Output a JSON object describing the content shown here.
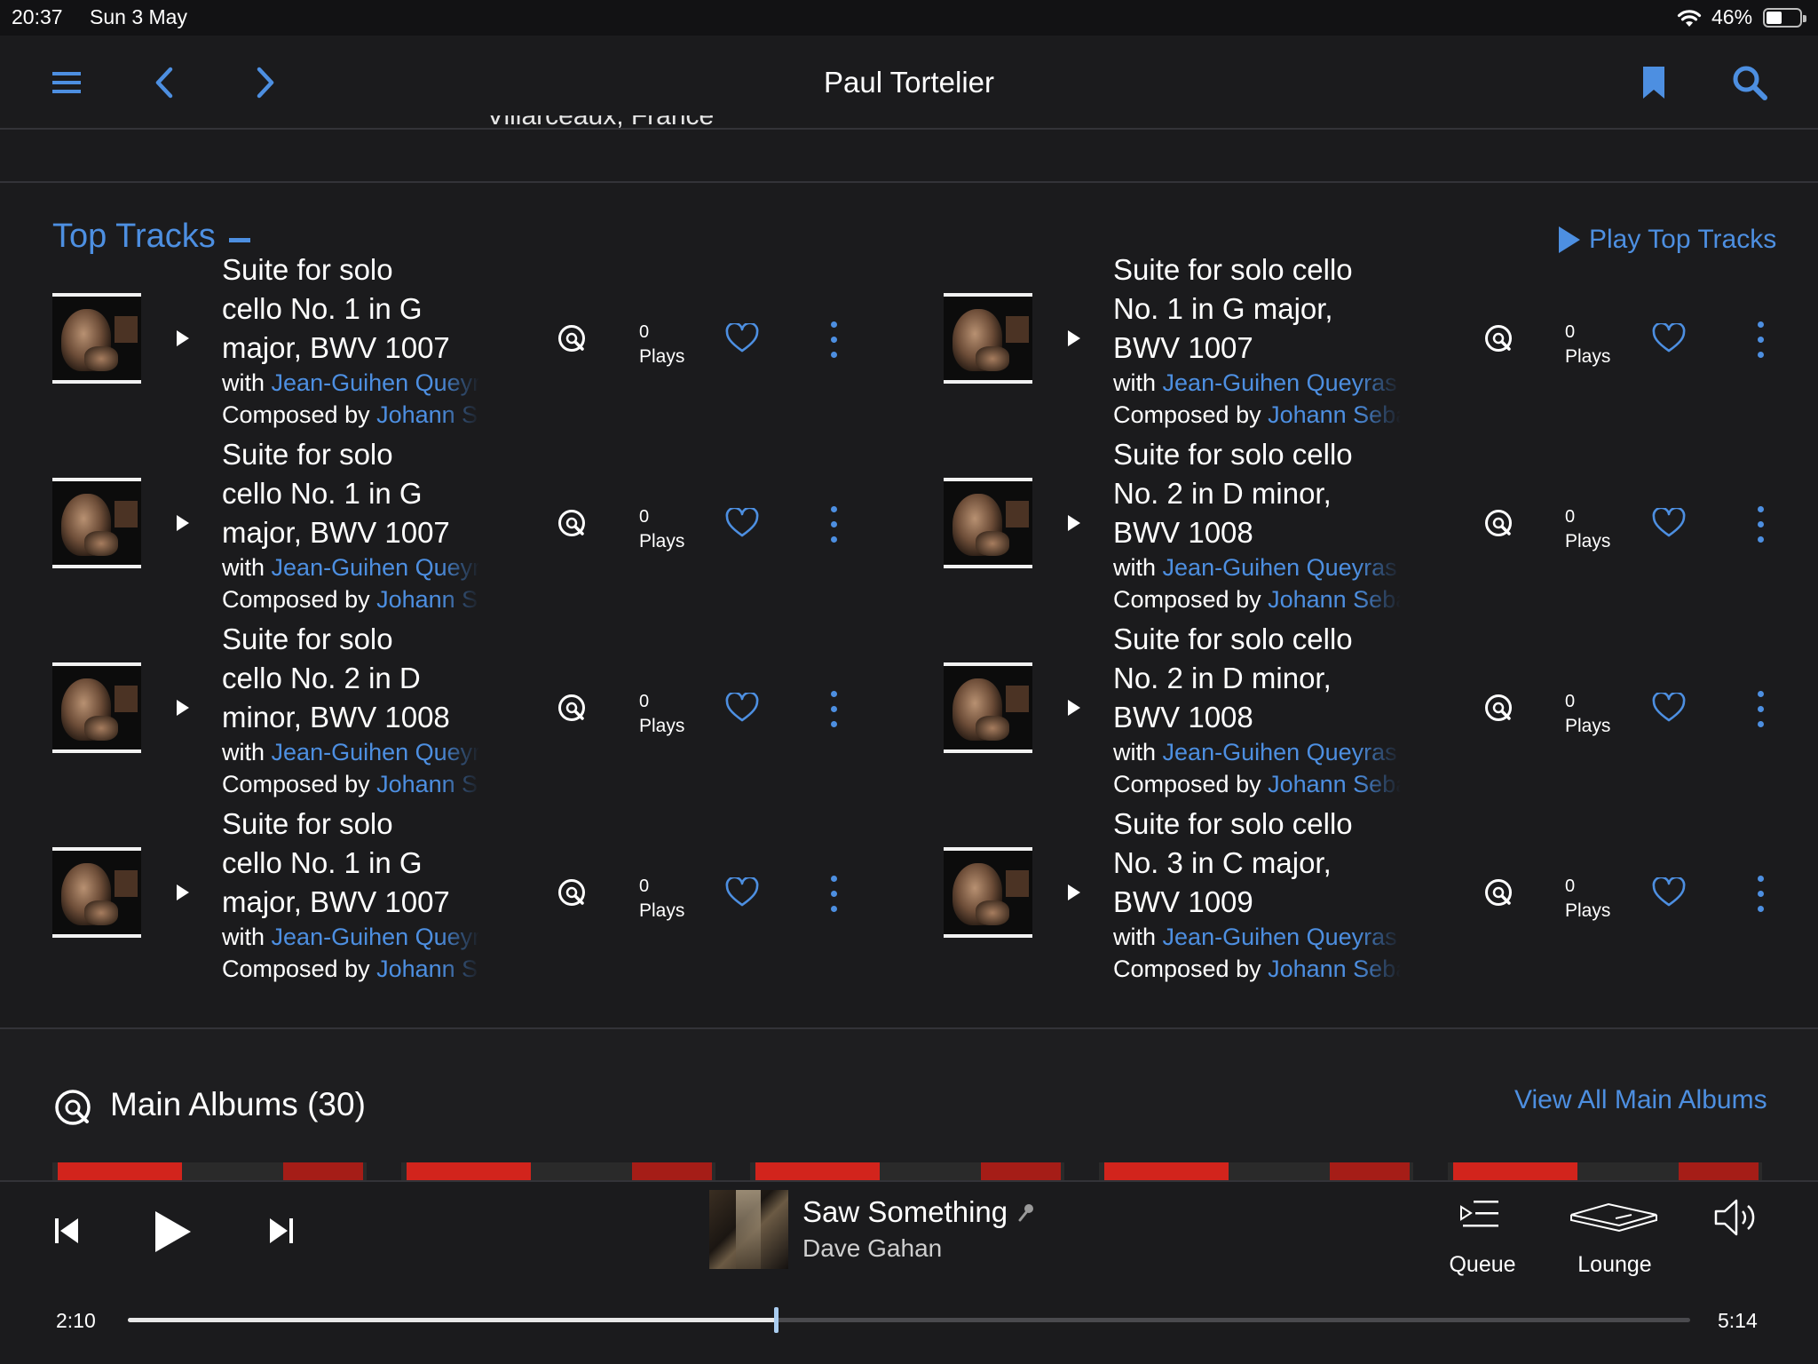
{
  "status_bar": {
    "time": "20:37",
    "date": "Sun 3 May",
    "battery_percent": "46%",
    "battery_level": 0.46
  },
  "nav": {
    "title": "Paul Tortelier",
    "menu_icon": "hamburger-menu-icon",
    "back_icon": "chevron-left-icon",
    "forward_icon": "chevron-right-icon",
    "bookmark_icon": "bookmark-icon",
    "search_icon": "search-icon"
  },
  "clipped_text": "Villarceaux, France",
  "top_tracks": {
    "title": "Top Tracks",
    "play_label": "Play Top Tracks",
    "tracks": [
      {
        "title_lines": [
          "Suite for solo",
          "cello No. 1 in G",
          "major, BWV 1007"
        ],
        "with_prefix": "with ",
        "with_name": "Jean-Guihen Queyras",
        "composed_prefix": "Composed by ",
        "composer": "Johann Sebastian Bach",
        "plays_count": "0",
        "plays_label": "Plays"
      },
      {
        "title_lines": [
          "Suite for solo cello",
          "No. 1 in G major,",
          "BWV 1007"
        ],
        "with_prefix": "with ",
        "with_name": "Jean-Guihen Queyras",
        "composed_prefix": "Composed by ",
        "composer": "Johann Sebastian Bach",
        "plays_count": "0",
        "plays_label": "Plays"
      },
      {
        "title_lines": [
          "Suite for solo",
          "cello No. 1 in G",
          "major, BWV 1007"
        ],
        "with_prefix": "with ",
        "with_name": "Jean-Guihen Queyras",
        "composed_prefix": "Composed by ",
        "composer": "Johann Sebastian Bach",
        "plays_count": "0",
        "plays_label": "Plays"
      },
      {
        "title_lines": [
          "Suite for solo cello",
          "No. 2 in D minor,",
          "BWV 1008"
        ],
        "with_prefix": "with ",
        "with_name": "Jean-Guihen Queyras",
        "composed_prefix": "Composed by ",
        "composer": "Johann Sebastian Bach",
        "plays_count": "0",
        "plays_label": "Plays"
      },
      {
        "title_lines": [
          "Suite for solo",
          "cello No. 2 in D",
          "minor, BWV 1008"
        ],
        "with_prefix": "with ",
        "with_name": "Jean-Guihen Queyras",
        "composed_prefix": "Composed by ",
        "composer": "Johann Sebastian Bach",
        "plays_count": "0",
        "plays_label": "Plays"
      },
      {
        "title_lines": [
          "Suite for solo cello",
          "No. 2 in D minor,",
          "BWV 1008"
        ],
        "with_prefix": "with ",
        "with_name": "Jean-Guihen Queyras",
        "composed_prefix": "Composed by ",
        "composer": "Johann Sebastian Bach",
        "plays_count": "0",
        "plays_label": "Plays"
      },
      {
        "title_lines": [
          "Suite for solo",
          "cello No. 1 in G",
          "major, BWV 1007"
        ],
        "with_prefix": "with ",
        "with_name": "Jean-Guihen Queyras",
        "composed_prefix": "Composed by ",
        "composer": "Johann Sebastian Bach",
        "plays_count": "0",
        "plays_label": "Plays"
      },
      {
        "title_lines": [
          "Suite for solo cello",
          "No. 3 in C major,",
          "BWV 1009"
        ],
        "with_prefix": "with ",
        "with_name": "Jean-Guihen Queyras",
        "composed_prefix": "Composed by ",
        "composer": "Johann Sebastian Bach",
        "plays_count": "0",
        "plays_label": "Plays"
      }
    ]
  },
  "main_albums": {
    "title": "Main Albums (30)",
    "view_all_label": "View All Main Albums"
  },
  "player": {
    "track_title": "Saw Something",
    "artist": "Dave Gahan",
    "queue_label": "Queue",
    "zone_label": "Lounge",
    "elapsed": "2:10",
    "total": "5:14",
    "progress": 0.415
  },
  "colors": {
    "accent": "#4d8fe1",
    "background": "#1b1b1d",
    "text": "#ffffff"
  }
}
